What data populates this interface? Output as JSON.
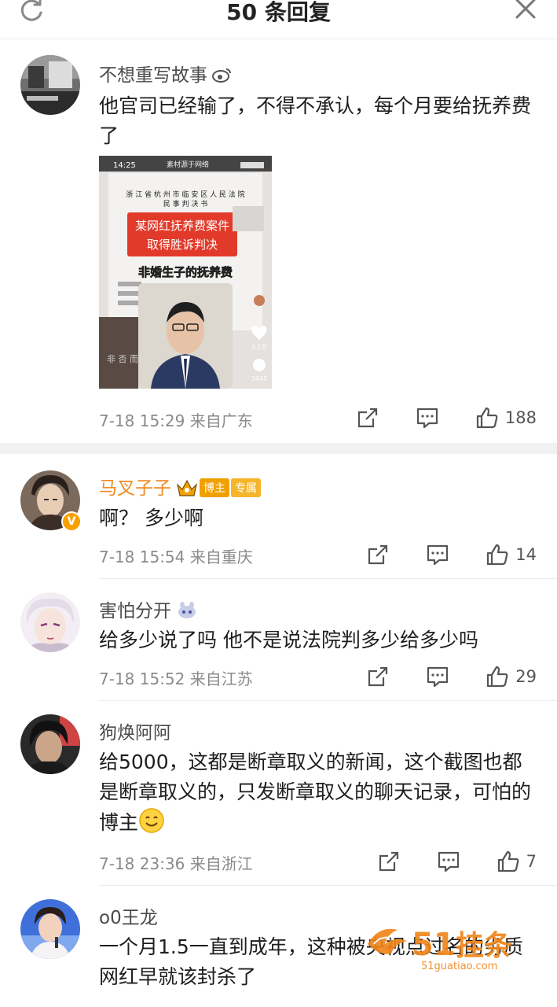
{
  "header": {
    "title": "50 条回复",
    "refresh_icon": "refresh-icon",
    "close_icon": "close-icon"
  },
  "post": {
    "author": "不想重写故事",
    "text": "他官司已经输了，不得不承认，每个月要给抚养费了",
    "image": {
      "status_time": "14:25",
      "source": "素材源于网络",
      "court": "浙 江 省 杭 州 市 临 安 区 人 民 法 院",
      "doc_type": "民 事 判 决 书",
      "banner_line1": "某网红抚养费案件",
      "banner_line2": "取得胜诉判决",
      "subtitle": "非婚生子的抚养费",
      "likes": "3.1万",
      "comments": "3445",
      "side_chars": "非 否 而 生 抚 扭 理"
    },
    "time": "7-18 15:29",
    "location": "来自广东",
    "likes": "188"
  },
  "replies": [
    {
      "name": "马叉子子",
      "tag_blogger": "博主",
      "tag_exclusive": "专属",
      "text": "啊？ 多少啊",
      "time": "7-18 15:54",
      "location": "来自重庆",
      "likes": "14"
    },
    {
      "name": "害怕分开",
      "text": "给多少说了吗 他不是说法院判多少给多少吗",
      "time": "7-18 15:52",
      "location": "来自江苏",
      "likes": "29"
    },
    {
      "name": "狗焕阿阿",
      "text": "给5000，这都是断章取义的新闻，这个截图也都是断章取义的，只发断章取义的聊天记录，可怕的博主",
      "time": "7-18 23:36",
      "location": "来自浙江",
      "likes": "7"
    },
    {
      "name": "o0王龙",
      "text": "一个月1.5一直到成年，这种被央视点过名的劣质网红早就该封杀了"
    }
  ],
  "watermark": {
    "brand": "51",
    "brand_cn": "挂条",
    "url": "51guatiao.com"
  },
  "colors": {
    "accent_orange": "#f08a24",
    "text_gray": "#8a8a8a",
    "divider": "#ececec"
  }
}
